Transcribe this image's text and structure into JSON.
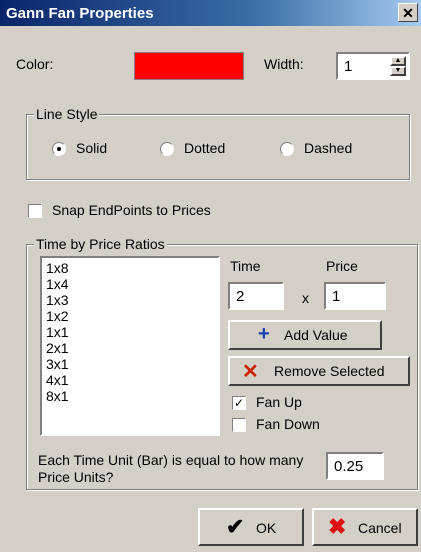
{
  "window": {
    "title": "Gann Fan Properties",
    "close_glyph": "✕"
  },
  "color_row": {
    "label": "Color:",
    "swatch_color": "#ff0000",
    "width_label": "Width:",
    "width_value": "1"
  },
  "line_style": {
    "legend": "Line Style",
    "options": [
      "Solid",
      "Dotted",
      "Dashed"
    ],
    "selected": "Solid"
  },
  "snap": {
    "label": "Snap EndPoints to Prices",
    "checked": false
  },
  "ratios": {
    "legend": "Time by Price Ratios",
    "items": [
      "1x8",
      "1x4",
      "1x3",
      "1x2",
      "1x1",
      "2x1",
      "3x1",
      "4x1",
      "8x1"
    ],
    "time_label": "Time",
    "price_label": "Price",
    "time_value": "2",
    "separator": "x",
    "price_value": "1",
    "add_label": "Add Value",
    "remove_label": "Remove Selected",
    "fan_up_label": "Fan Up",
    "fan_up_checked": true,
    "fan_down_label": "Fan Down",
    "fan_down_checked": false,
    "unit_label": "Each Time Unit (Bar) is equal to how many Price Units?",
    "unit_value": "0.25"
  },
  "buttons": {
    "ok_label": "OK",
    "cancel_label": "Cancel"
  },
  "colors": {
    "plus": "#1a3fb0",
    "remove_x": "#cc2200",
    "ok_check": "#000000",
    "cancel_x": "#dd1111"
  }
}
